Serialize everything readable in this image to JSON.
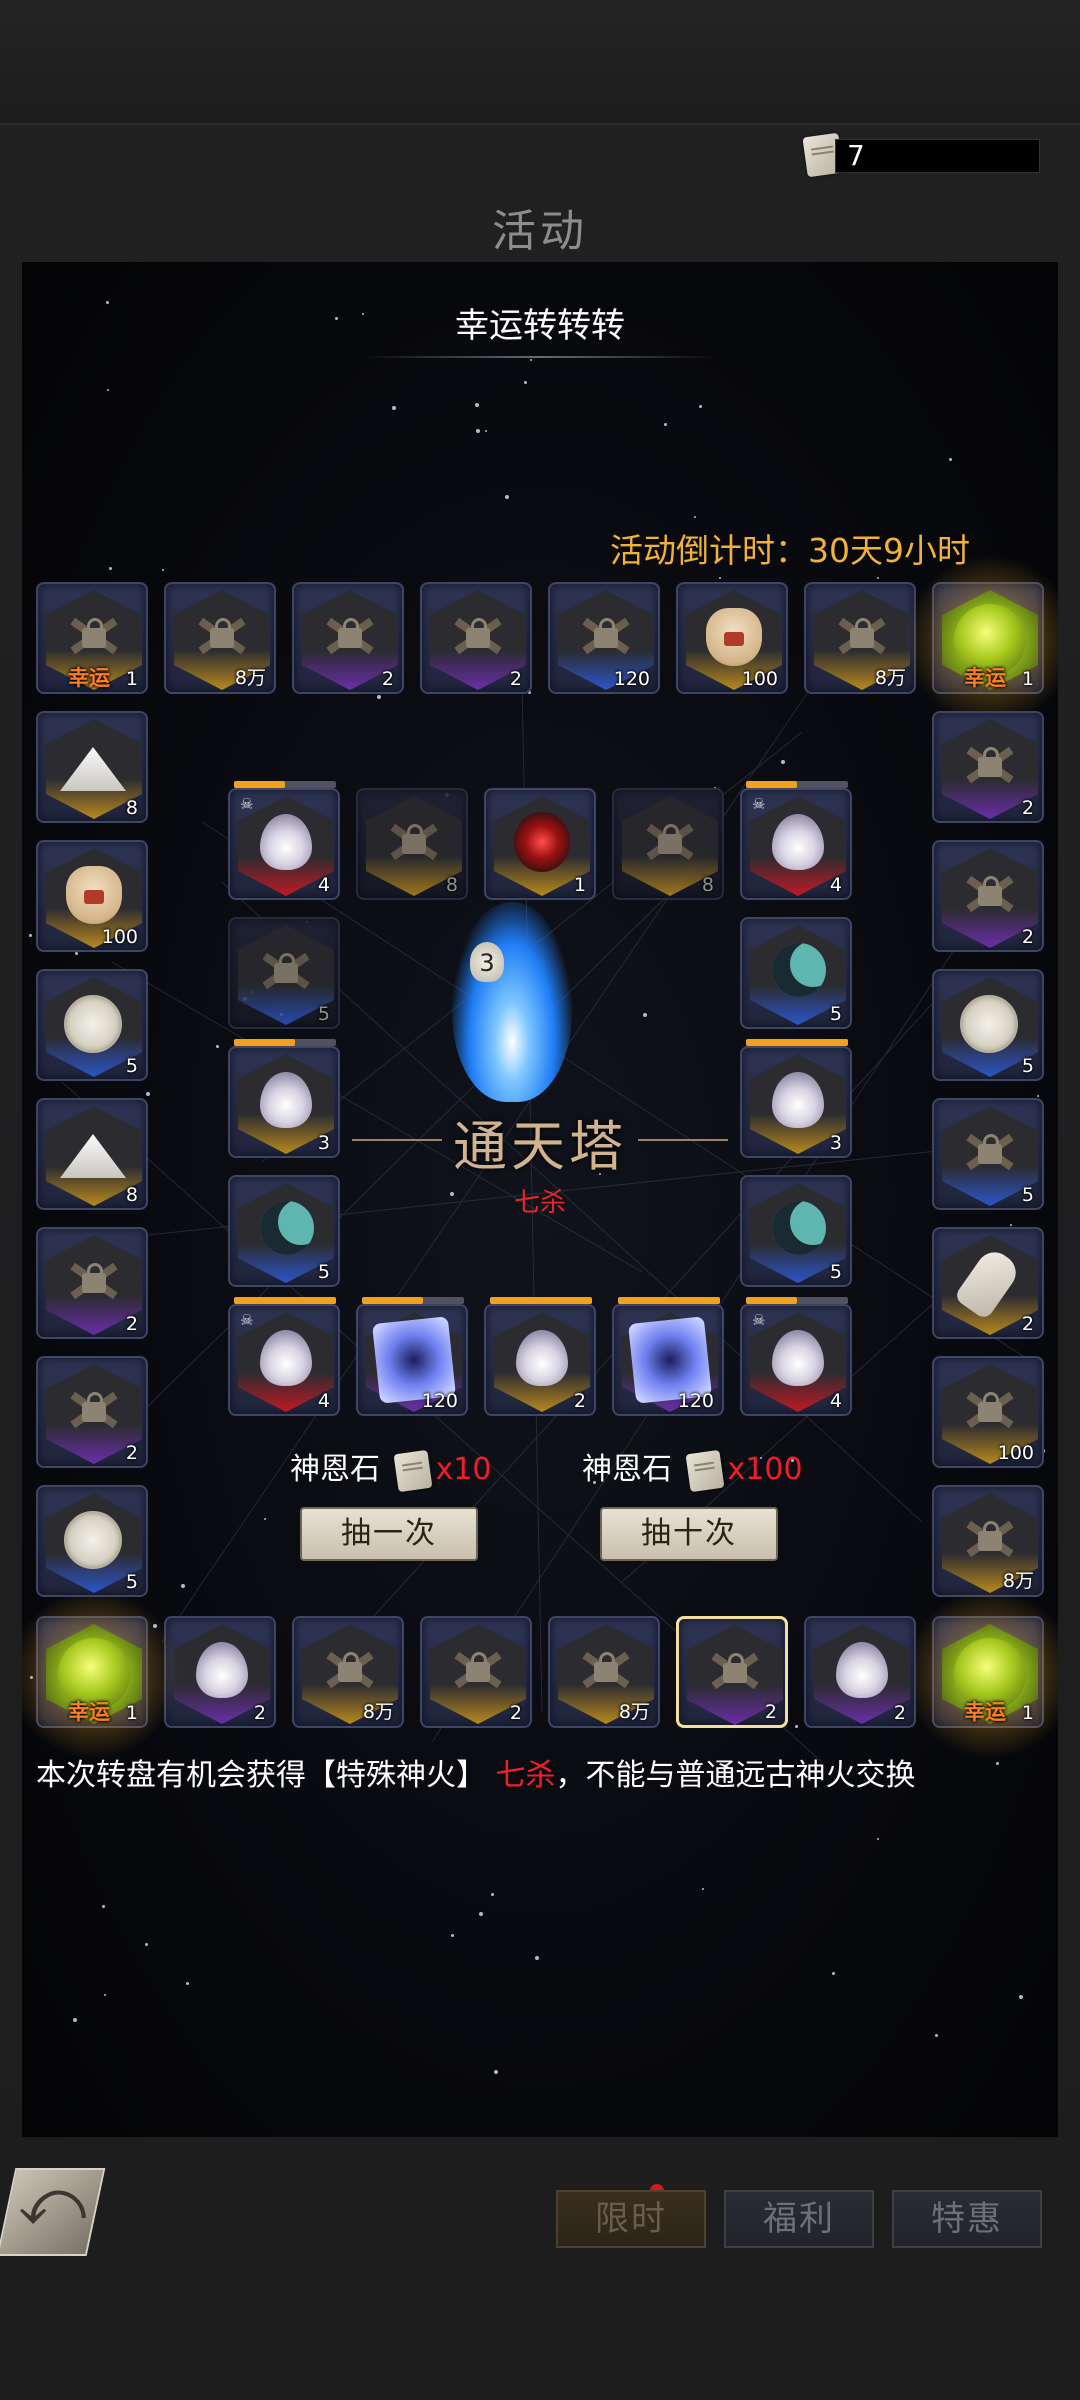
{
  "header": {
    "title": "活动",
    "currency": "7"
  },
  "event": {
    "title": "幸运转转转",
    "countdown": "活动倒计时：30天9小时"
  },
  "outer_ring": [
    {
      "item": "lock",
      "hex": "gold",
      "count": "1",
      "lucky": "幸运"
    },
    {
      "item": "lock",
      "hex": "gold",
      "count": "8万"
    },
    {
      "item": "lock",
      "hex": "purple",
      "count": "2"
    },
    {
      "item": "lock",
      "hex": "purple",
      "count": "2"
    },
    {
      "item": "lock",
      "hex": "blue",
      "count": "120"
    },
    {
      "item": "bag",
      "hex": "gold",
      "count": "100"
    },
    {
      "item": "lock",
      "hex": "gold",
      "count": "8万"
    },
    {
      "item": "orb",
      "hex": "green",
      "count": "1",
      "lucky": "幸运",
      "glow": true
    },
    {
      "item": "lock",
      "hex": "purple",
      "count": "2"
    },
    {
      "item": "lock",
      "hex": "purple",
      "count": "2"
    },
    {
      "item": "watch",
      "hex": "blue",
      "count": "5"
    },
    {
      "item": "lock",
      "hex": "blue",
      "count": "5"
    },
    {
      "item": "bone",
      "hex": "gold",
      "count": "2"
    },
    {
      "item": "lock",
      "hex": "gold",
      "count": "100"
    },
    {
      "item": "lock",
      "hex": "gold",
      "count": "8万"
    },
    {
      "item": "orb",
      "hex": "green",
      "count": "1",
      "lucky": "幸运",
      "glow": true
    },
    {
      "item": "flame",
      "hex": "purple",
      "count": "2"
    },
    {
      "item": "lock",
      "hex": "purple",
      "count": "2",
      "selected": true
    },
    {
      "item": "lock",
      "hex": "gold",
      "count": "8万"
    },
    {
      "item": "lock",
      "hex": "gold",
      "count": "2"
    },
    {
      "item": "lock",
      "hex": "gold",
      "count": "8万"
    },
    {
      "item": "flame",
      "hex": "purple",
      "count": "2"
    },
    {
      "item": "orb",
      "hex": "green",
      "count": "1",
      "lucky": "幸运",
      "glow": true
    },
    {
      "item": "watch",
      "hex": "blue",
      "count": "5"
    },
    {
      "item": "lock",
      "hex": "purple",
      "count": "2"
    },
    {
      "item": "lock",
      "hex": "purple",
      "count": "2"
    },
    {
      "item": "sand",
      "hex": "gold",
      "count": "8"
    },
    {
      "item": "watch",
      "hex": "blue",
      "count": "5"
    },
    {
      "item": "bag",
      "hex": "gold",
      "count": "100"
    },
    {
      "item": "sand",
      "hex": "gold",
      "count": "8"
    }
  ],
  "inner_ring": [
    {
      "item": "flame",
      "hex": "red",
      "count": "4",
      "progress": 0.5,
      "skull": true
    },
    {
      "item": "lock",
      "hex": "gold",
      "count": "8",
      "dim": true
    },
    {
      "item": "eye",
      "hex": "gold",
      "count": "1"
    },
    {
      "item": "lock",
      "hex": "gold",
      "count": "8",
      "dim": true
    },
    {
      "item": "flame",
      "hex": "red",
      "count": "4",
      "progress": 0.5,
      "skull": true
    },
    {
      "item": "moon",
      "hex": "blue",
      "count": "5"
    },
    {
      "item": "flame",
      "hex": "gold",
      "count": "3",
      "progress": 1
    },
    {
      "item": "moon",
      "hex": "blue",
      "count": "5"
    },
    {
      "item": "flame",
      "hex": "red",
      "count": "4",
      "progress": 0.5,
      "skull": true
    },
    {
      "item": "cube",
      "hex": "purple",
      "count": "120",
      "progress": 1
    },
    {
      "item": "flame",
      "hex": "gold",
      "count": "2",
      "progress": 1
    },
    {
      "item": "cube",
      "hex": "purple",
      "count": "120",
      "progress": 0.6
    },
    {
      "item": "flame",
      "hex": "red",
      "count": "4",
      "progress": 1,
      "skull": true
    },
    {
      "item": "moon",
      "hex": "blue",
      "count": "5"
    },
    {
      "item": "flame",
      "hex": "gold",
      "count": "3",
      "progress": 0.6
    },
    {
      "item": "lock",
      "hex": "blue",
      "count": "5",
      "dim": true
    }
  ],
  "center": {
    "tower_count": "3",
    "name": "通天塔",
    "subname": "七杀"
  },
  "draw": {
    "single": {
      "label": "神恩石",
      "cost": "x10",
      "button": "抽一次"
    },
    "ten": {
      "label": "神恩石",
      "cost": "x100",
      "button": "抽十次"
    }
  },
  "note": {
    "prefix": "本次转盘有机会获得【特殊神火】",
    "highlight": "七杀",
    "suffix": "，不能与普通远古神火交换"
  },
  "nav": {
    "tabs": [
      "限时",
      "福利",
      "特惠"
    ],
    "active": 0
  }
}
